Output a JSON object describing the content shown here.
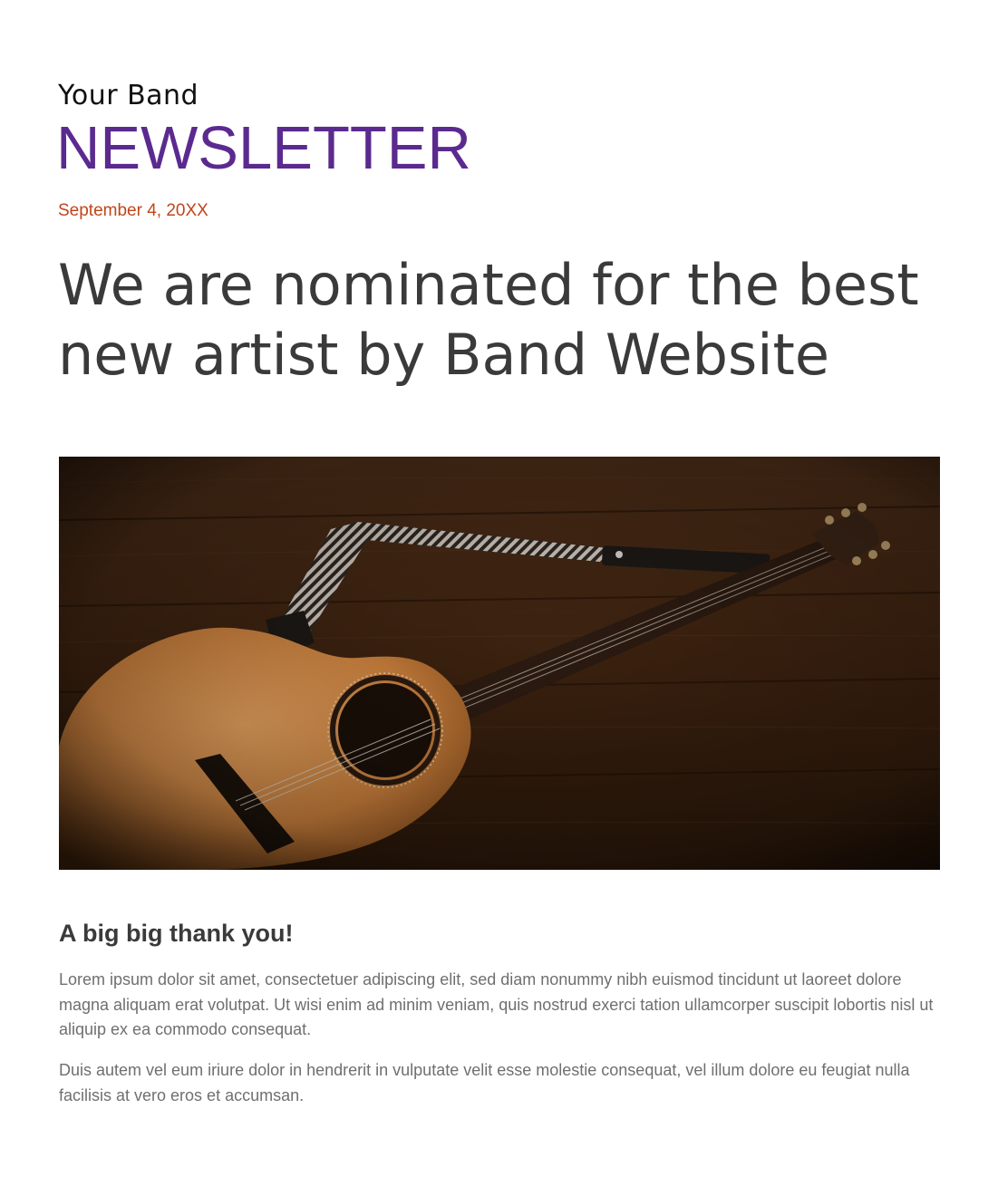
{
  "header": {
    "band_name": "Your Band",
    "title": "NEWSLETTER",
    "date": "September 4, 20XX"
  },
  "article": {
    "headline": "We are nominated for the best new artist by Band Website",
    "image_subject": "acoustic-guitar-on-wood-photo",
    "section_heading": "A big big thank you!",
    "paragraphs": [
      "Lorem ipsum dolor sit amet, consectetuer adipiscing elit, sed diam nonummy nibh euismod tincidunt ut laoreet dolore magna aliquam erat volutpat. Ut wisi enim ad minim veniam, quis nostrud exerci tation ullamcorper suscipit lobortis nisl ut aliquip ex ea commodo consequat.",
      "Duis autem vel eum iriure dolor in hendrerit in vulputate velit esse molestie consequat, vel illum dolore eu feugiat nulla facilisis at vero eros et accumsan."
    ]
  },
  "colors": {
    "title_purple": "#5b2a8f",
    "date_orange": "#c0461a",
    "headline_gray": "#3a3a3a",
    "body_gray": "#6f6f6f"
  }
}
